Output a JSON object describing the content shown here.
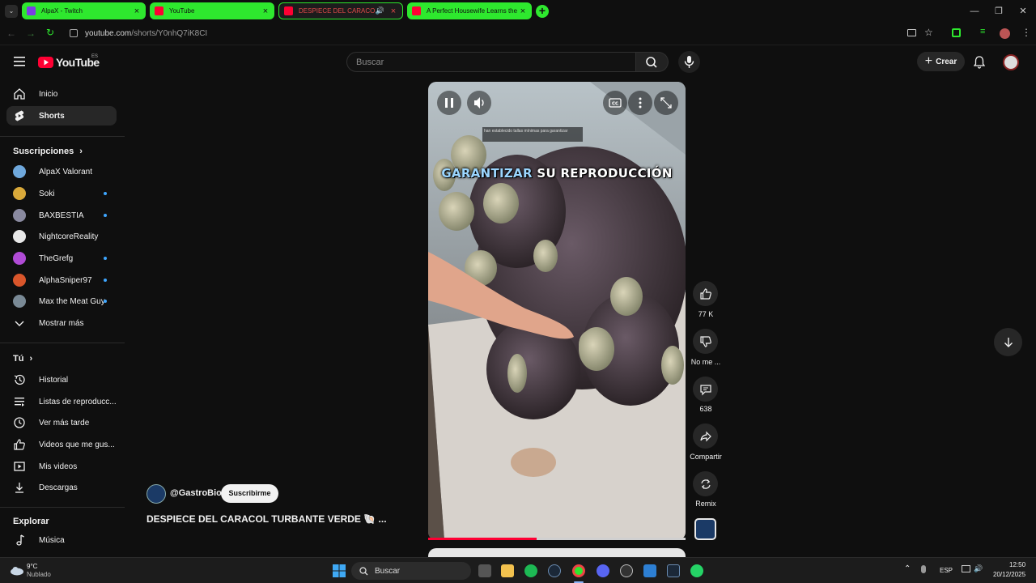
{
  "browser": {
    "tabs": [
      {
        "label": "AlpaX - Twitch",
        "favicon_color": "#9146ff",
        "active": false
      },
      {
        "label": "YouTube",
        "favicon_color": "#ff0033",
        "active": false
      },
      {
        "label": "DESPIECE DEL CARACOL TURBANTE",
        "favicon_color": "#ff0033",
        "active": true,
        "audio": true
      },
      {
        "label": "A Perfect Housewife Learns the",
        "favicon_color": "#ff0033",
        "active": false
      }
    ],
    "url_host": "youtube.com",
    "url_path": "/shorts/Y0nhQ7iK8CI"
  },
  "header": {
    "logo_text": "YouTube",
    "country_code": "ES",
    "search_placeholder": "Buscar",
    "create_label": "Crear"
  },
  "sidebar": {
    "main": [
      {
        "label": "Inicio",
        "icon": "home-icon"
      },
      {
        "label": "Shorts",
        "icon": "shorts-icon",
        "active": true
      }
    ],
    "subscriptions_title": "Suscripciones",
    "subscriptions": [
      {
        "label": "AlpaX Valorant",
        "color": "#6fa8dc",
        "dot": false
      },
      {
        "label": "Soki",
        "color": "#d9a93a",
        "dot": true
      },
      {
        "label": "BAXBESTIA",
        "color": "#8a8aa0",
        "dot": true
      },
      {
        "label": "NightcoreReality",
        "color": "#e8e8e8",
        "dot": false
      },
      {
        "label": "TheGrefg",
        "color": "#b04bd6",
        "dot": true
      },
      {
        "label": "AlphaSniper97",
        "color": "#d9562b",
        "dot": true
      },
      {
        "label": "Max the Meat Guy",
        "color": "#7a8a96",
        "dot": true
      }
    ],
    "show_more": "Mostrar más",
    "you_title": "Tú",
    "you_items": [
      {
        "label": "Historial",
        "icon": "history-icon"
      },
      {
        "label": "Listas de reproducc...",
        "icon": "playlist-icon"
      },
      {
        "label": "Ver más tarde",
        "icon": "clock-icon"
      },
      {
        "label": "Videos que me gus...",
        "icon": "thumb-up-icon"
      },
      {
        "label": "Mis videos",
        "icon": "video-icon"
      },
      {
        "label": "Descargas",
        "icon": "download-icon"
      }
    ],
    "explore_title": "Explorar",
    "explore_items": [
      {
        "label": "Música",
        "icon": "music-icon"
      }
    ]
  },
  "short": {
    "small_subtitle": "han establecido tallas mínimas para garantizar",
    "caption_highlight": "GARANTIZAR",
    "caption_rest": " SU REPRODUCCIÓN",
    "progress": 0.42,
    "channel": "@GastroBio",
    "subscribe_label": "Suscribirme",
    "title": "DESPIECE DEL CARACOL TURBANTE VERDE 🐚 ...",
    "actions": {
      "likes": "77 K",
      "dislike_label": "No me ...",
      "comments": "638",
      "share_label": "Compartir",
      "remix_label": "Remix"
    }
  },
  "taskbar": {
    "weather_temp": "9°C",
    "weather_desc": "Nublado",
    "search_label": "Buscar",
    "language": "ESP",
    "time": "12:50",
    "date": "20/12/2025"
  }
}
